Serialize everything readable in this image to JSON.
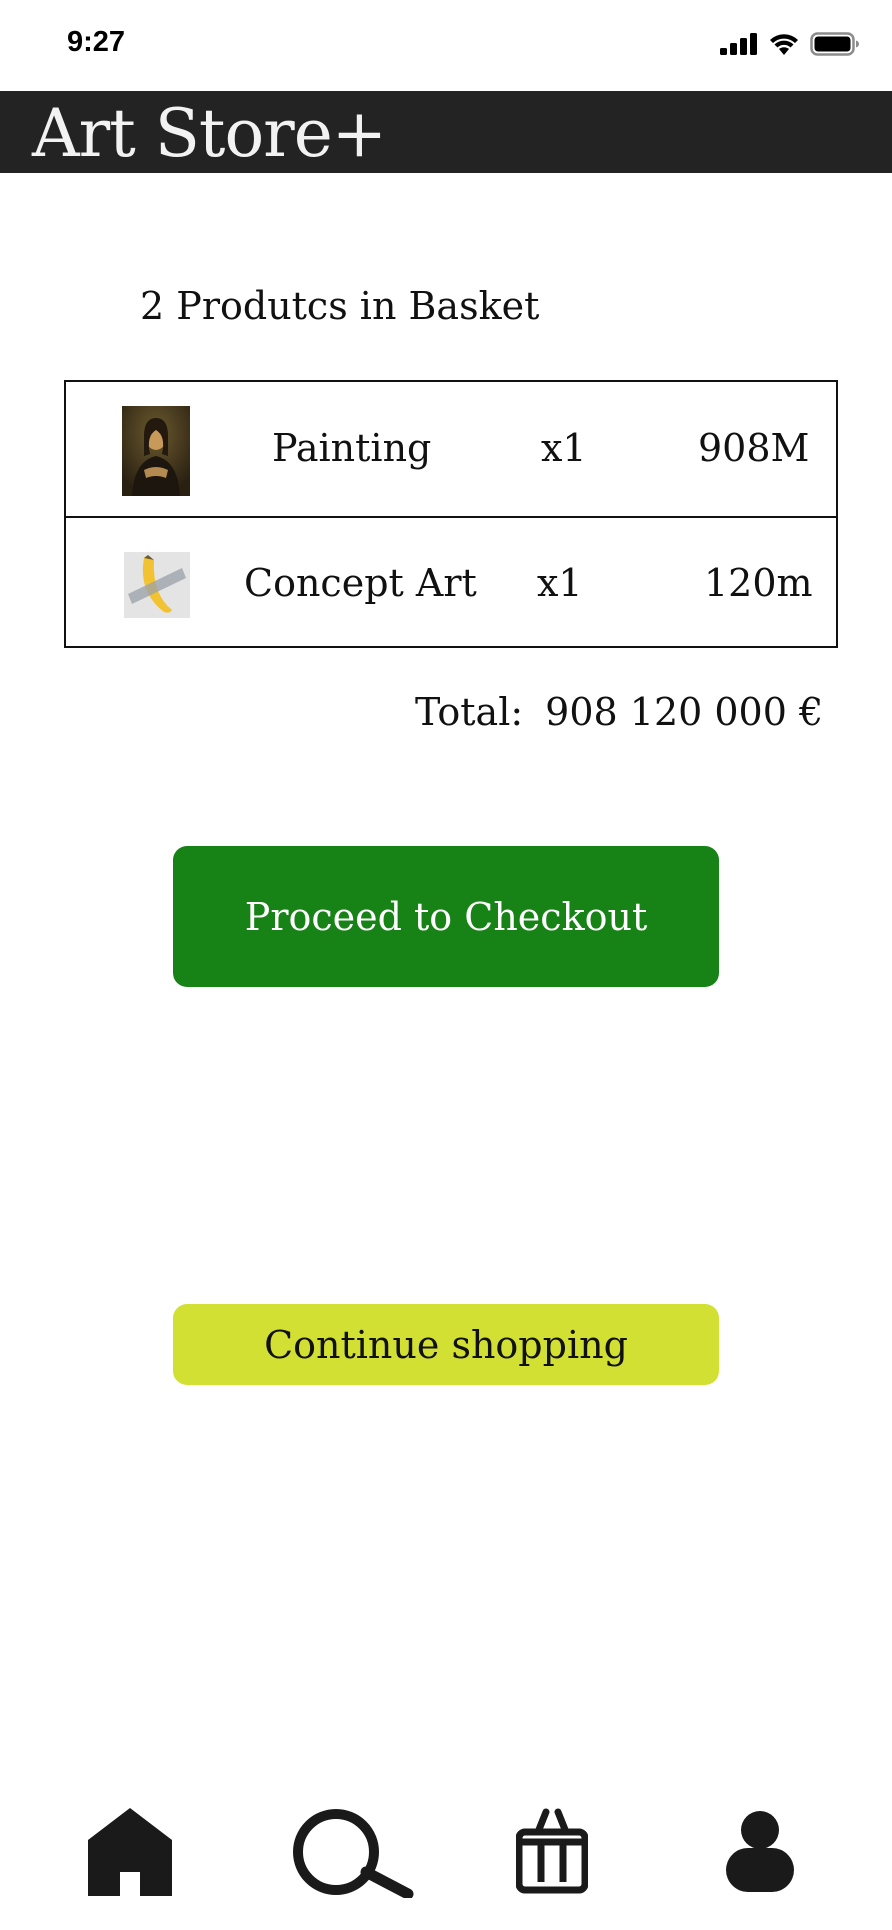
{
  "status_bar": {
    "time": "9:27",
    "icons": [
      "cellular-signal-icon",
      "wifi-icon",
      "battery-icon"
    ]
  },
  "header": {
    "title": "Art Store+"
  },
  "basket": {
    "count_label": "2 Produtcs in Basket",
    "items": [
      {
        "name": "Painting",
        "quantity": "x1",
        "price": "908M",
        "thumbnail": "mona-lisa-painting-thumbnail"
      },
      {
        "name": "Concept Art",
        "quantity": "x1",
        "price": "120m",
        "thumbnail": "taped-banana-artwork-thumbnail"
      }
    ],
    "total_label": "Total:",
    "total_value": "908 120 000 €"
  },
  "actions": {
    "checkout_label": "Proceed to Checkout",
    "continue_label": "Continue shopping"
  },
  "bottom_nav": {
    "items": [
      "home-icon",
      "search-icon",
      "basket-icon",
      "profile-icon"
    ]
  },
  "colors": {
    "header_bg": "#232323",
    "checkout_bg": "#178316",
    "continue_bg": "#d2e034"
  }
}
